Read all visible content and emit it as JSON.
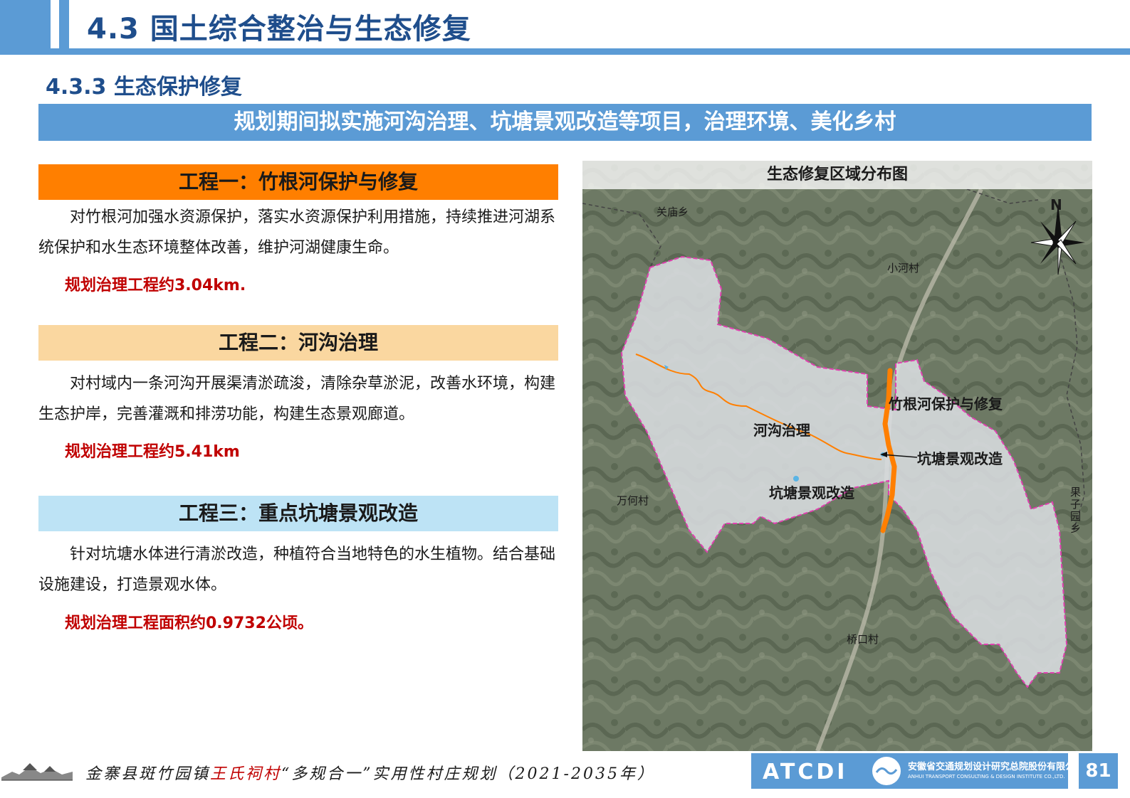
{
  "header": {
    "title": "4.3 国土综合整治与生态修复"
  },
  "section": {
    "subtitle": "4.3.3 生态保护修复"
  },
  "banner": {
    "text": "规划期间拟实施河沟治理、坑塘景观改造等项目，治理环境、美化乡村"
  },
  "projects": [
    {
      "heading": "工程一：竹根河保护与修复",
      "color": "#ff7f00",
      "description": "对竹根河加强水资源保护，落实水资源保护利用措施，持续推进河湖系统保护和水生态环境整体改善，维护河湖健康生命。",
      "note": "规划治理工程约3.04km."
    },
    {
      "heading": "工程二：河沟治理",
      "color": "#fad7a0",
      "description": "对村域内一条河沟开展渠清淤疏浚，清除杂草淤泥，改善水环境，构建生态护岸，完善灌溉和排涝功能，构建生态景观廊道。",
      "note": "规划治理工程约5.41km"
    },
    {
      "heading": "工程三：重点坑塘景观改造",
      "color": "#bde3f5",
      "description": "针对坑塘水体进行清淤改造，种植符合当地特色的水生植物。结合基础设施建设，打造景观水体。",
      "note": "规划治理工程面积约0.9732公顷。"
    }
  ],
  "map": {
    "title": "生态修复区域分布图",
    "north": "N",
    "villages": {
      "guanmiao": "关庙乡",
      "xiaohe": "小河村",
      "wanhe": "万何村",
      "guoziyuan": "果子园乡",
      "qiaokou": "桥口村"
    },
    "labels": {
      "zhugenhe": "竹根河保护与修复",
      "hegou": "河沟治理",
      "kengtang_right": "坑塘景观改造",
      "kengtang_center": "坑塘景观改造"
    },
    "colors": {
      "boundary": "#e040b0",
      "river": "#ff7f00"
    }
  },
  "footer": {
    "prefix": "金寨县斑竹园镇",
    "village": "王氏祠村",
    "suffix": "“多规合一”实用性村庄规划（2021-2035年）",
    "logo_mark": "ATCDI",
    "logo_cn": "安徽省交通规划设计研究总院股份有限公司",
    "logo_en": "ANHUI TRANSPORT CONSULTING & DESIGN INSTITUTE CO.,LTD.",
    "page": "81"
  }
}
